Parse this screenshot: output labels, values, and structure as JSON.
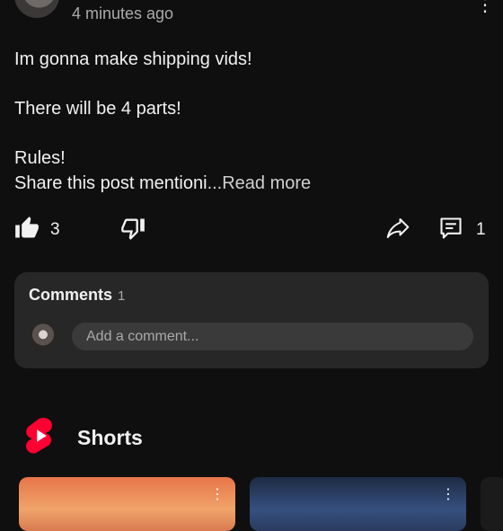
{
  "post": {
    "timestamp": "4 minutes ago",
    "lines": [
      "Im gonna make shipping vids!",
      "There will be 4 parts!",
      "Rules!"
    ],
    "truncated_line": "Share this post mentioni",
    "read_more": "...Read more"
  },
  "actions": {
    "like_count": "3",
    "comment_count": "1"
  },
  "comments": {
    "title": "Comments",
    "count": "1",
    "input_placeholder": "Add a comment..."
  },
  "shorts": {
    "title": "Shorts"
  },
  "colors": {
    "background": "#0f0f0f",
    "card": "#272727",
    "input": "#3a3a3a",
    "shorts_red": "#ff0033",
    "secondary_text": "#aaaaaa"
  }
}
